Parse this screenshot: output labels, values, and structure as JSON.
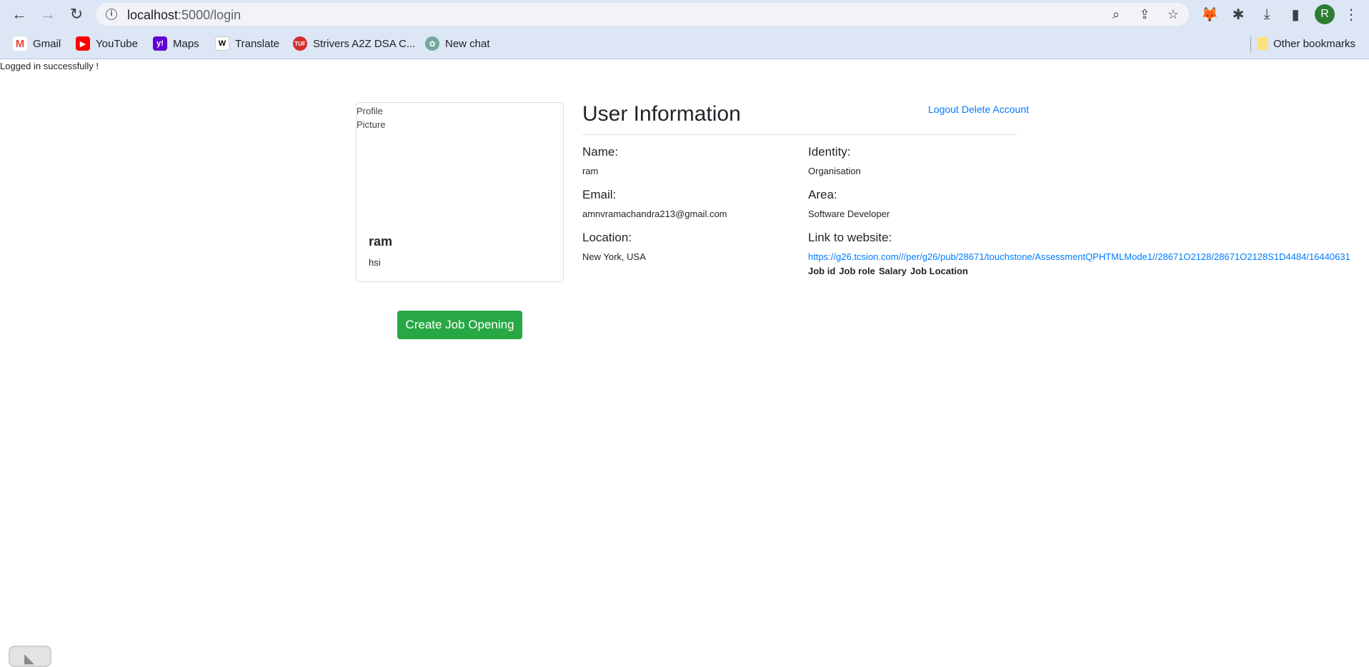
{
  "browser": {
    "url_host": "localhost",
    "url_path": ":5000/login",
    "avatar_letter": "R",
    "bookmarks": [
      {
        "label": "Gmail",
        "icon": "gmail-icon",
        "color": "#ea4335"
      },
      {
        "label": "YouTube",
        "icon": "youtube-icon",
        "color": "#ff0000"
      },
      {
        "label": "Maps",
        "icon": "yahoo-icon",
        "color": "#6001d2"
      },
      {
        "label": "Translate",
        "icon": "wikipedia-icon",
        "color": "#ffffff"
      },
      {
        "label": "Strivers A2Z DSA C...",
        "icon": "tuf-icon",
        "color": "#d32f2f"
      },
      {
        "label": "New chat",
        "icon": "chatgpt-icon",
        "color": "#74aa9c"
      }
    ],
    "other_bookmarks": "Other bookmarks"
  },
  "flash": "Logged in successfully !",
  "profile": {
    "image_alt": "Profile Picture",
    "name": "ram",
    "bio": "hsi"
  },
  "actions": {
    "create_job": "Create Job Opening",
    "logout": "Logout",
    "delete_account": "Delete Account"
  },
  "user_info": {
    "title": "User Information",
    "name_label": "Name:",
    "name_value": "ram",
    "identity_label": "Identity:",
    "identity_value": "Organisation",
    "email_label": "Email:",
    "email_value": "amnvramachandra213@gmail.com",
    "area_label": "Area:",
    "area_value": "Software Developer",
    "location_label": "Location:",
    "location_value": "New York, USA",
    "website_label": "Link to website:",
    "website_value": "https://g26.tcsion.com///per/g26/pub/28671/touchstone/AssessmentQPHTMLMode1//28671O2128/28671O2128S1D4484/16440631"
  },
  "jobs_table": {
    "headers": [
      "Job id",
      "Job role",
      "Salary",
      "Job Location"
    ]
  },
  "colors": {
    "accent": "#007bff",
    "success": "#28a745",
    "chrome": "#dde6f5"
  }
}
